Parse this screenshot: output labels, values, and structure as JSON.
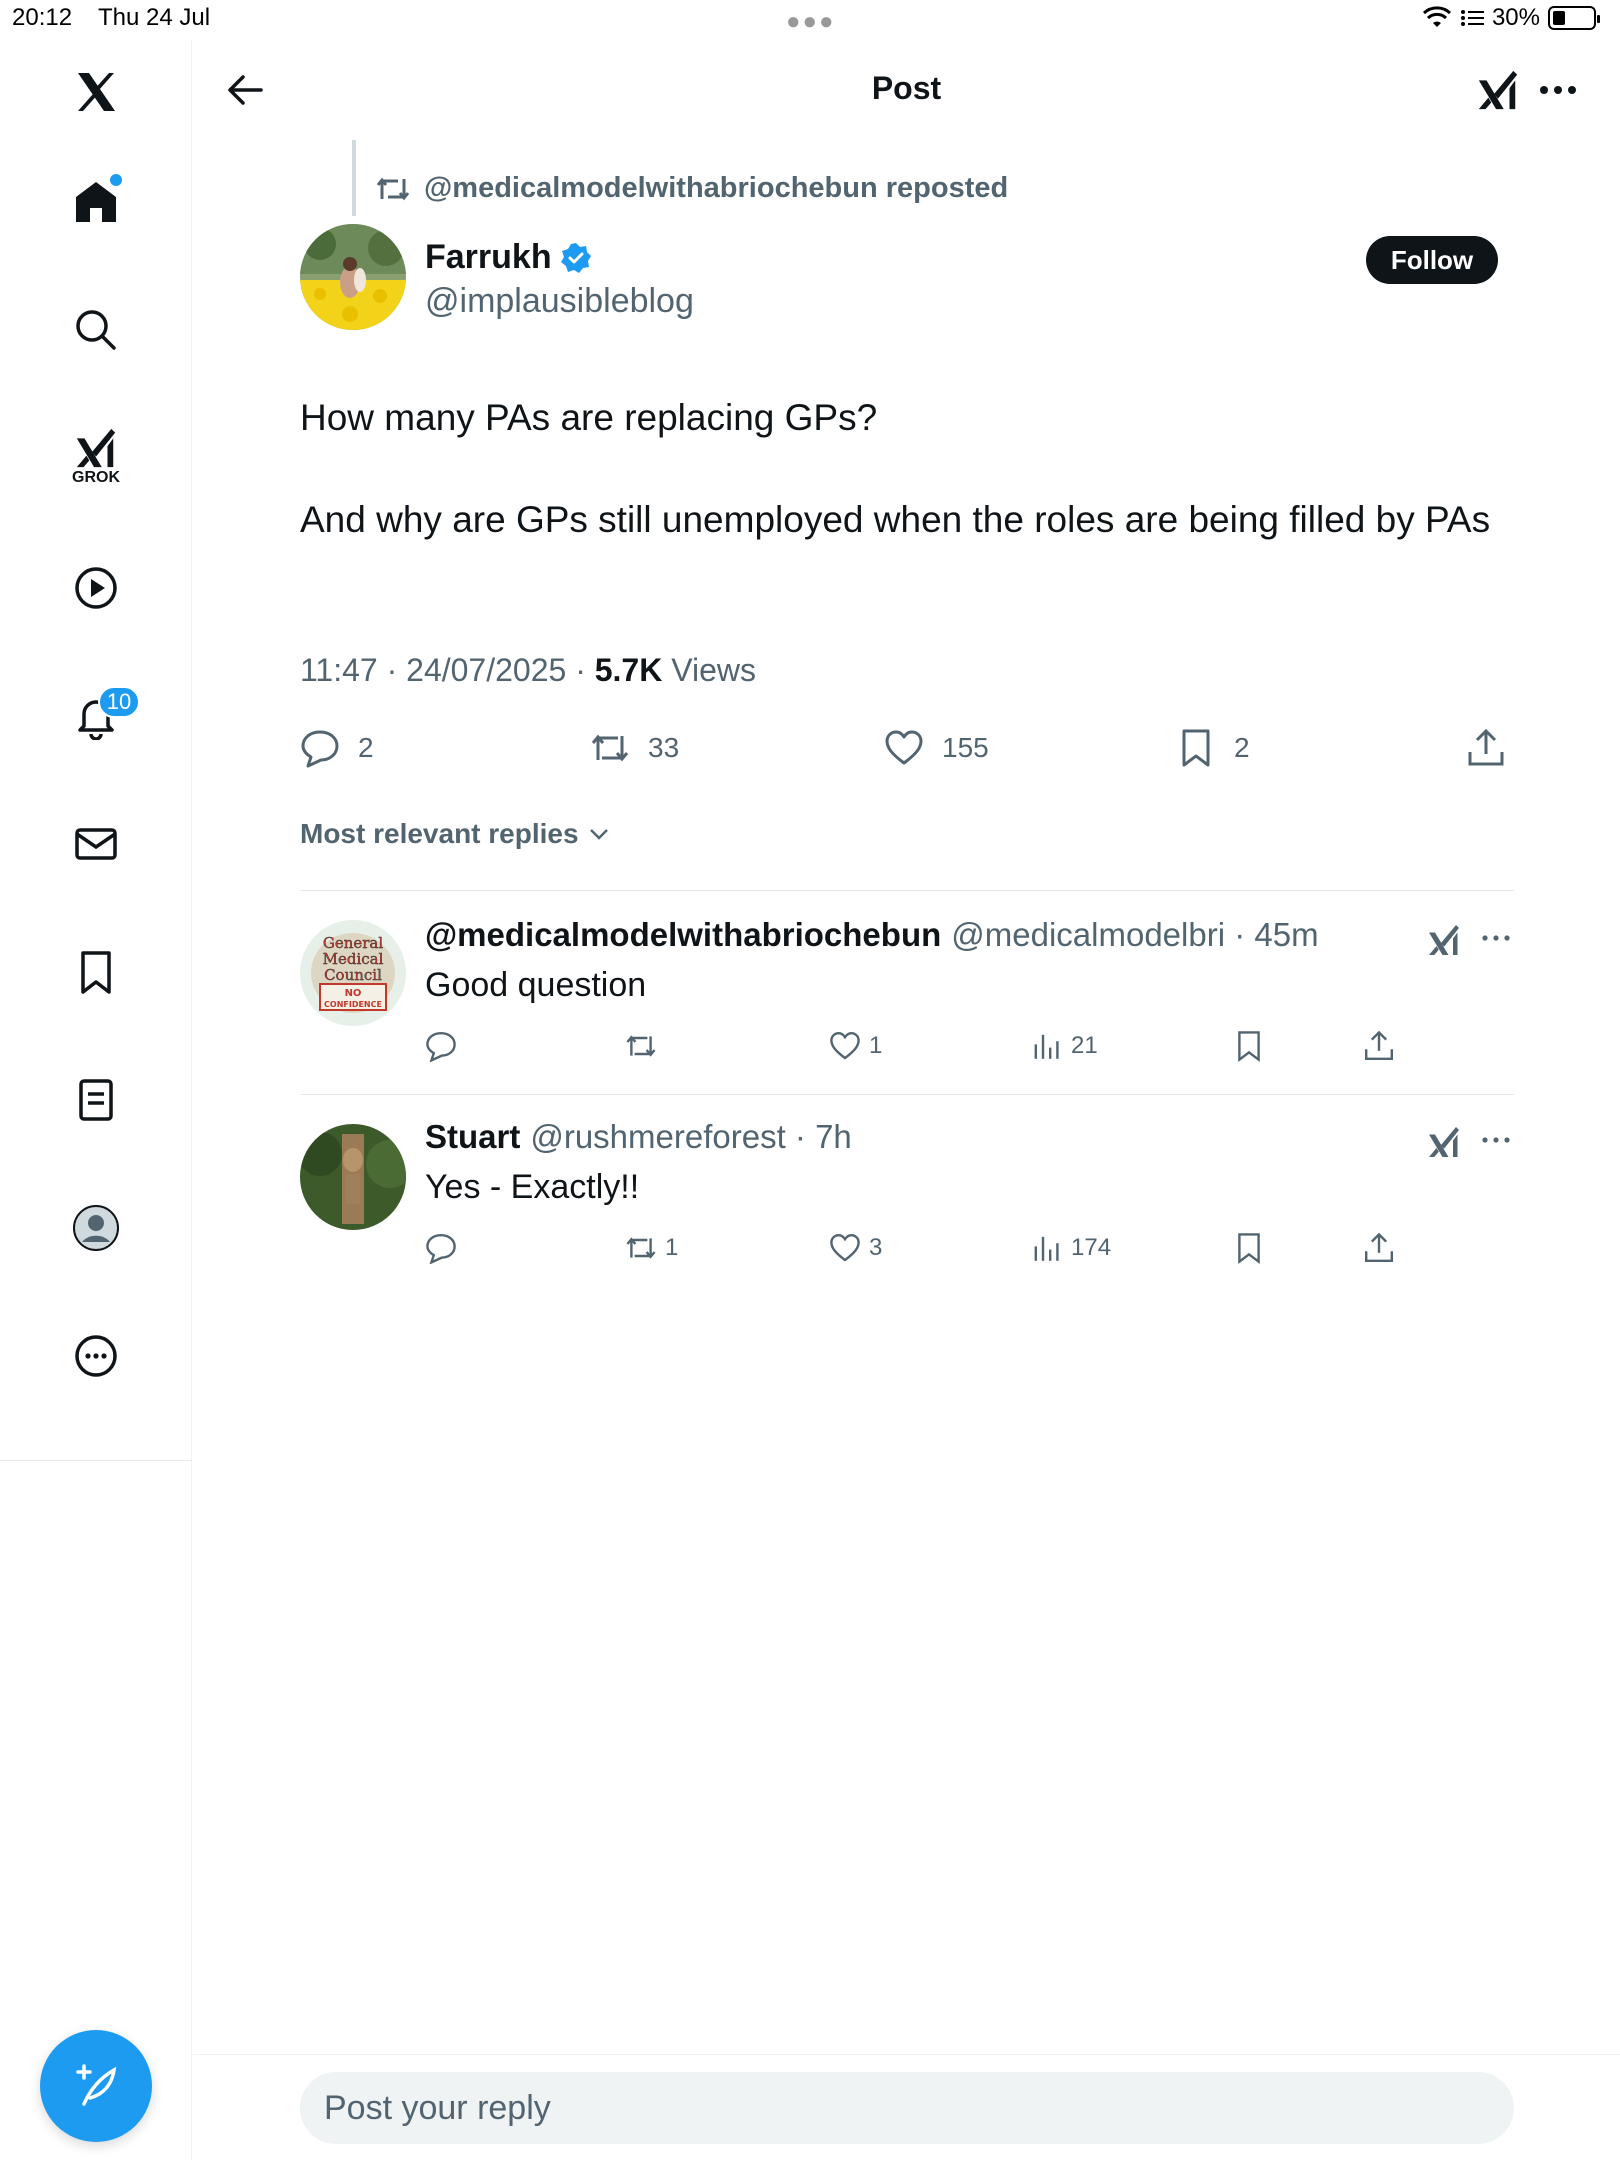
{
  "status_bar": {
    "time": "20:12",
    "date": "Thu 24 Jul",
    "battery": "30%"
  },
  "sidebar": {
    "grok_label": "GROK",
    "notifications_count": "10"
  },
  "header": {
    "title": "Post"
  },
  "post": {
    "repost_label": "@medicalmodelwithabriochebun reposted",
    "author_name": "Farrukh",
    "author_handle": "@implausibleblog",
    "follow_label": "Follow",
    "text_p1": "How many PAs are replacing GPs?",
    "text_p2": "And why are GPs still unemployed when the roles are being filled by PAs",
    "timestamp": "11:47 · 24/07/2025 · ",
    "views_count": "5.7K",
    "views_label": " Views",
    "replies": "2",
    "reposts": "33",
    "likes": "155",
    "bookmarks": "2"
  },
  "replies_sort": {
    "label": "Most relevant replies"
  },
  "replies": [
    {
      "name": "@medicalmodelwithabriochebun",
      "handle": "@medicalmodelbri · 45m",
      "text": "Good question",
      "reposts": "",
      "likes": "1",
      "views": "21",
      "avatar_text": [
        "General",
        "Medical",
        "Council",
        "NO",
        "CONFIDENCE"
      ]
    },
    {
      "name": "Stuart",
      "handle": "@rushmereforest · 7h",
      "text": "Yes - Exactly!!",
      "reposts": "1",
      "likes": "3",
      "views": "174"
    }
  ],
  "compose": {
    "placeholder": "Post your reply"
  },
  "colors": {
    "accent": "#1d9bf0",
    "text": "#0f1419",
    "secondary": "#536471"
  }
}
